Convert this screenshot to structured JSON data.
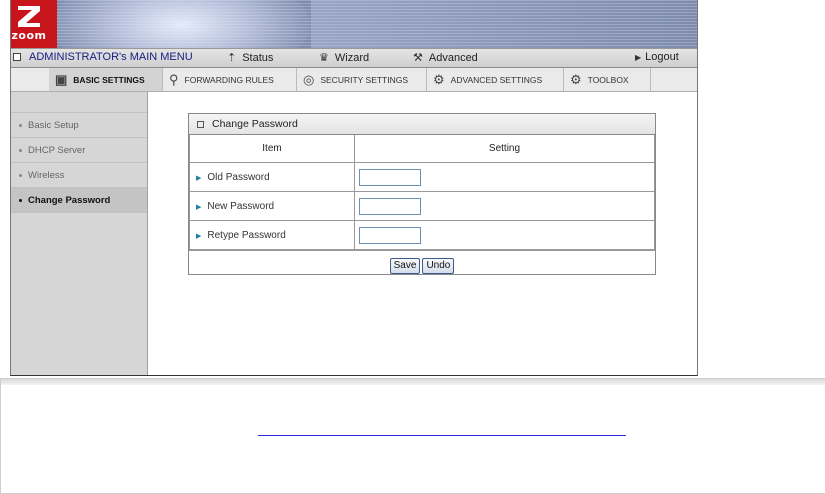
{
  "brand": {
    "logo_word": "zoom"
  },
  "menu": {
    "admin_label": "ADMINISTRATOR's MAIN MENU",
    "items": [
      {
        "icon": "status-icon",
        "label": "Status"
      },
      {
        "icon": "wizard-icon",
        "label": "Wizard"
      },
      {
        "icon": "advanced-icon",
        "label": "Advanced"
      }
    ],
    "logout_label": "Logout"
  },
  "tabs": [
    {
      "icon": "basic-settings-icon",
      "label": "BASIC SETTINGS",
      "active": true
    },
    {
      "icon": "forwarding-rules-icon",
      "label": "FORWARDING RULES",
      "active": false
    },
    {
      "icon": "security-settings-icon",
      "label": "SECURITY SETTINGS",
      "active": false
    },
    {
      "icon": "advanced-settings-icon",
      "label": "ADVANCED SETTINGS",
      "active": false
    },
    {
      "icon": "toolbox-icon",
      "label": "TOOLBOX",
      "active": false
    }
  ],
  "sidebar": {
    "items": [
      {
        "label": "Basic Setup",
        "active": false
      },
      {
        "label": "DHCP Server",
        "active": false
      },
      {
        "label": "Wireless",
        "active": false
      },
      {
        "label": "Change Password",
        "active": true
      }
    ]
  },
  "panel": {
    "title": "Change Password",
    "col_item": "Item",
    "col_setting": "Setting",
    "rows": [
      {
        "label": "Old Password",
        "value": ""
      },
      {
        "label": "New Password",
        "value": ""
      },
      {
        "label": "Retype Password",
        "value": ""
      }
    ],
    "save_label": "Save",
    "undo_label": "Undo"
  },
  "colors": {
    "logo_red": "#c8141b",
    "banner_blue": "#8a97b8",
    "link_blue": "#2a2ae0",
    "input_border": "#6b8fb5"
  }
}
